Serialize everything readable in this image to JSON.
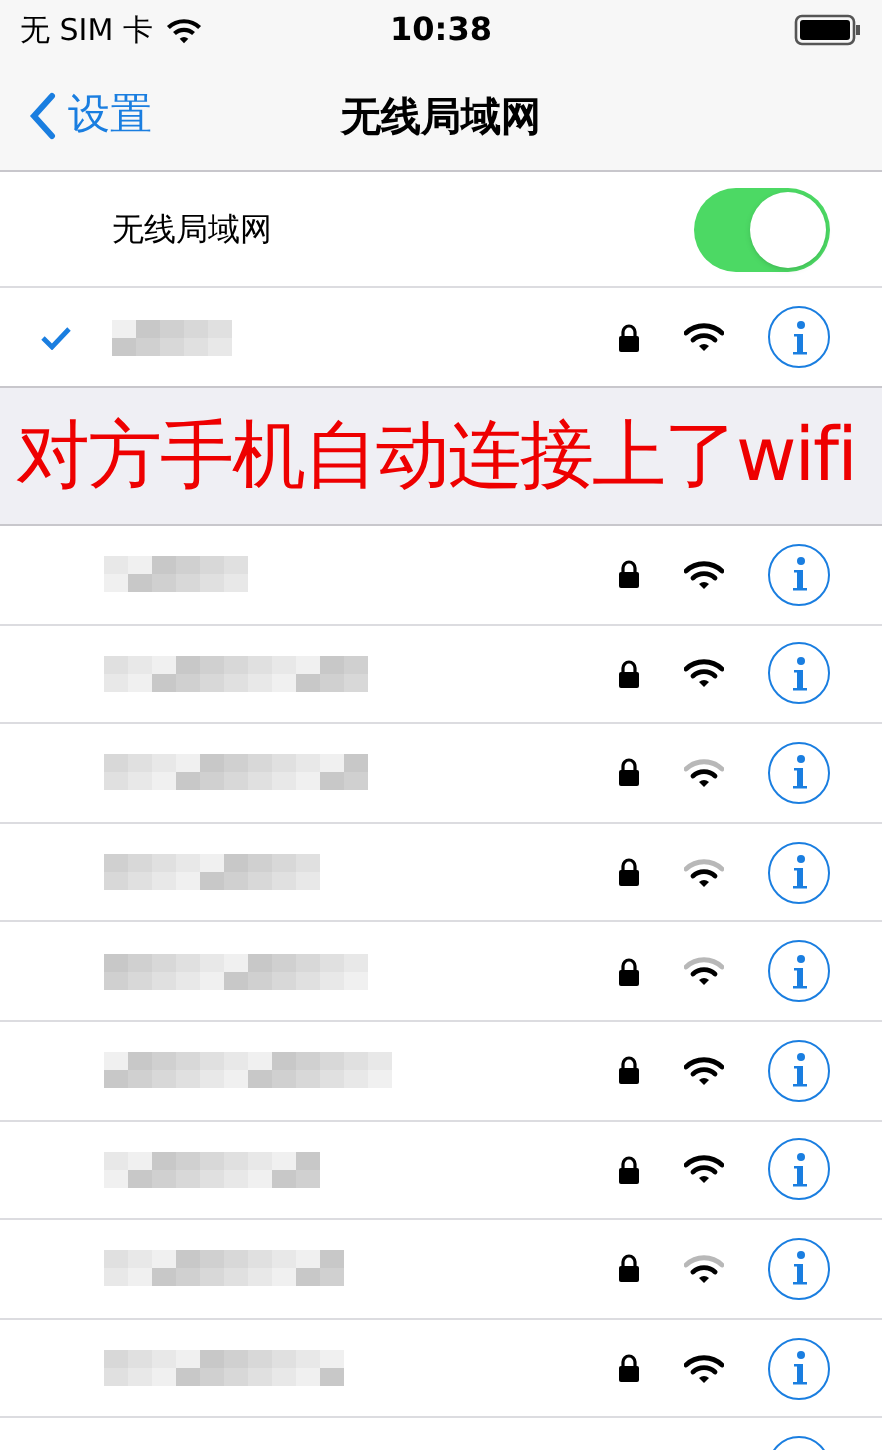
{
  "status_bar": {
    "carrier": "无 SIM 卡",
    "time": "10:38"
  },
  "nav": {
    "back": "设置",
    "title": "无线局域网"
  },
  "wifi_toggle": {
    "label": "无线局域网",
    "on": true
  },
  "connected": {
    "connected": true,
    "locked": true
  },
  "overlay_caption": "对方手机自动连接上了wifi",
  "networks": [
    {
      "locked": true
    },
    {
      "locked": true
    },
    {
      "locked": true
    },
    {
      "locked": true
    },
    {
      "locked": true
    },
    {
      "locked": true
    },
    {
      "locked": true
    },
    {
      "locked": true
    },
    {
      "locked": true
    }
  ]
}
